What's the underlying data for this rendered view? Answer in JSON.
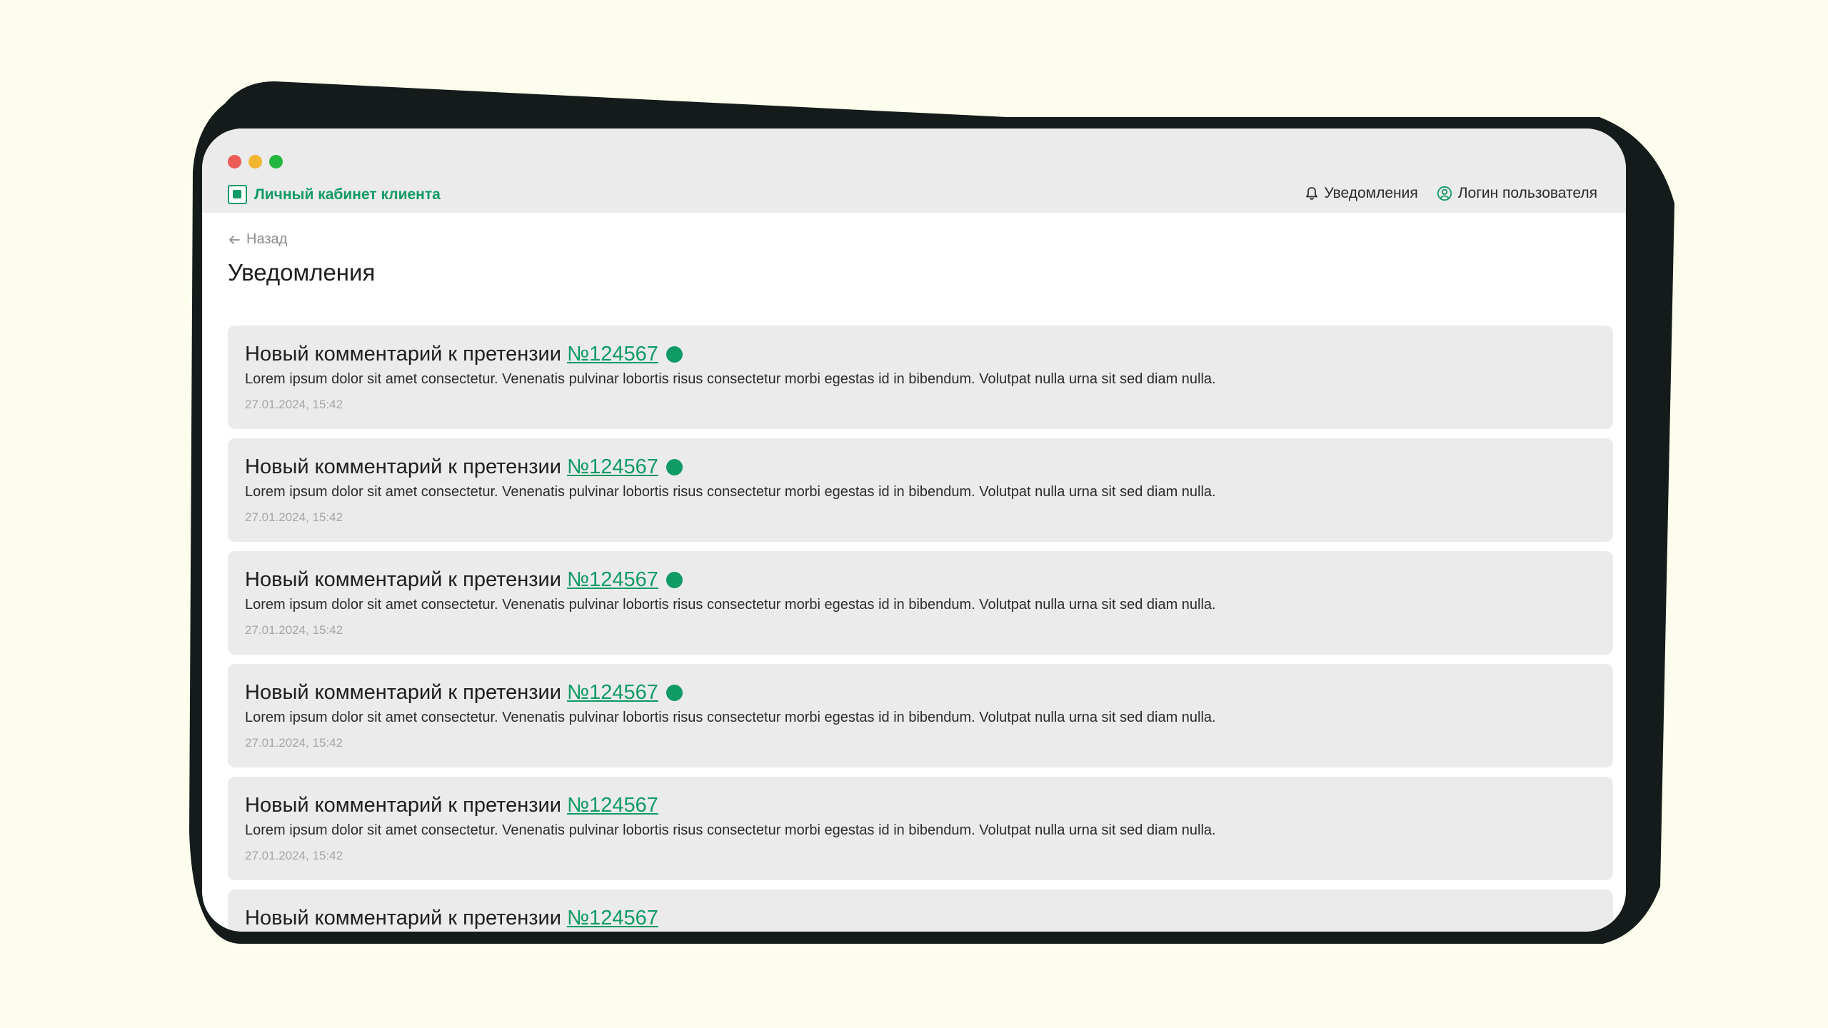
{
  "colors": {
    "background": "#FCFDEC",
    "frame": "#141B1A",
    "accent": "#0F9A66",
    "titlebar": "#EBEBEB",
    "card": "#EBEBEB",
    "dot_red": "#ED5B57",
    "dot_yellow": "#F2B530",
    "dot_green": "#23B63F"
  },
  "header": {
    "brand_title": "Личный кабинет клиента",
    "brand_icon": "brand-logo-icon",
    "nav": {
      "notifications_label": "Уведомления",
      "notifications_icon": "bell-icon",
      "user_label": "Логин пользователя",
      "user_icon": "user-circle-icon"
    }
  },
  "page": {
    "back_label": "Назад",
    "back_icon": "arrow-left-icon",
    "title": "Уведомления"
  },
  "notifications": [
    {
      "title": "Новый комментарий к претензии",
      "link": "№124567",
      "unread": true,
      "body": "Lorem ipsum dolor sit amet consectetur. Venenatis pulvinar lobortis risus consectetur morbi egestas id in bibendum. Volutpat nulla urna sit sed diam nulla.",
      "time": "27.01.2024, 15:42"
    },
    {
      "title": "Новый комментарий к претензии",
      "link": "№124567",
      "unread": true,
      "body": "Lorem ipsum dolor sit amet consectetur. Venenatis pulvinar lobortis risus consectetur morbi egestas id in bibendum. Volutpat nulla urna sit sed diam nulla.",
      "time": "27.01.2024, 15:42"
    },
    {
      "title": "Новый комментарий к претензии",
      "link": "№124567",
      "unread": true,
      "body": "Lorem ipsum dolor sit amet consectetur. Venenatis pulvinar lobortis risus consectetur morbi egestas id in bibendum. Volutpat nulla urna sit sed diam nulla.",
      "time": "27.01.2024, 15:42"
    },
    {
      "title": "Новый комментарий к претензии",
      "link": "№124567",
      "unread": true,
      "body": "Lorem ipsum dolor sit amet consectetur. Venenatis pulvinar lobortis risus consectetur morbi egestas id in bibendum. Volutpat nulla urna sit sed diam nulla.",
      "time": "27.01.2024, 15:42"
    },
    {
      "title": "Новый комментарий к претензии",
      "link": "№124567",
      "unread": false,
      "body": "Lorem ipsum dolor sit amet consectetur. Venenatis pulvinar lobortis risus consectetur morbi egestas id in bibendum. Volutpat nulla urna sit sed diam nulla.",
      "time": "27.01.2024, 15:42"
    },
    {
      "title": "Новый комментарий к претензии",
      "link": "№124567",
      "unread": false,
      "body": "",
      "time": ""
    }
  ]
}
